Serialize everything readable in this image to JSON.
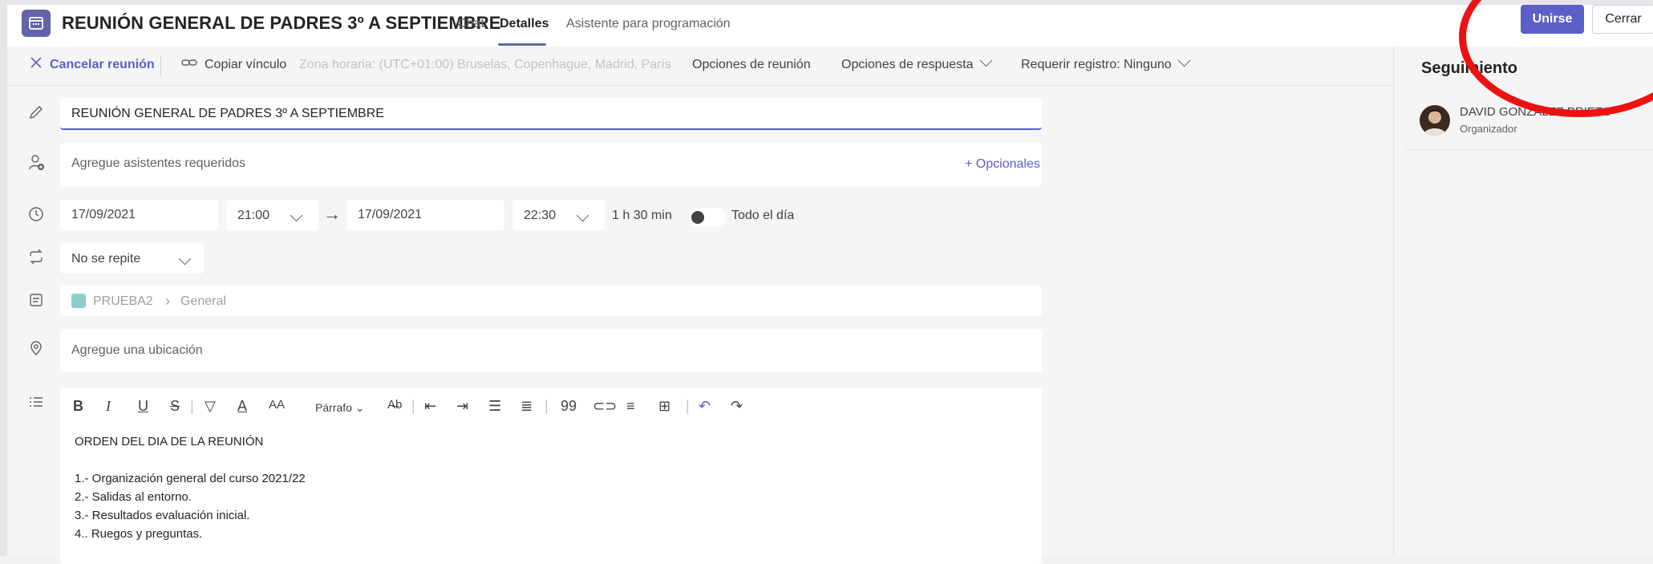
{
  "header": {
    "title": "REUNIÓN GENERAL DE PADRES 3º A SEPTIEMBRE",
    "tabs": [
      "Chat",
      "Detalles",
      "Asistente para programación"
    ],
    "join_label": "Unirse",
    "close_label": "Cerrar"
  },
  "toolbar": {
    "cancel": "Cancelar reunión",
    "copy_link": "Copiar vínculo",
    "timezone": "Zona horaria: (UTC+01:00) Bruselas, Copenhague, Madrid, París",
    "meeting_options": "Opciones de reunión",
    "response_options": "Opciones de respuesta",
    "registration": "Requerir registro: Ninguno"
  },
  "form": {
    "title_value": "REUNIÓN GENERAL DE PADRES 3º A SEPTIEMBRE",
    "attendees_placeholder": "Agregue asistentes requeridos",
    "optional_label": "+ Opcionales",
    "start_date": "17/09/2021",
    "start_time": "21:00",
    "end_date": "17/09/2021",
    "end_time": "22:30",
    "duration": "1 h 30 min",
    "all_day_label": "Todo el día",
    "repeat": "No se repite",
    "channel_team": "PRUEBA2",
    "channel_name": "General",
    "location_placeholder": "Agregue una ubicación"
  },
  "editor": {
    "paragraph_label": "Párrafo",
    "lines": [
      "ORDEN DEL DIA DE LA REUNIÓN",
      "",
      "1.- Organización general del curso 2021/22",
      "2.- Salidas al entorno.",
      "3.- Resultados evaluación inicial.",
      "4.. Ruegos y preguntas."
    ]
  },
  "tracking": {
    "title": "Seguimiento",
    "name": "DAVID GONZALEZ PRIETO",
    "role": "Organizador"
  },
  "colors": {
    "accent": "#6264a7",
    "annotation": "#ee1111"
  }
}
